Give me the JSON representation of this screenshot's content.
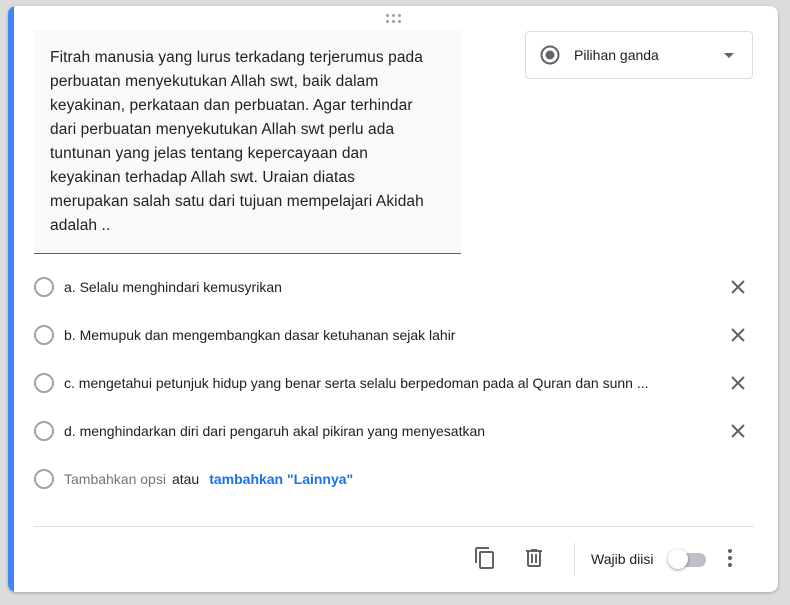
{
  "question": {
    "text": "Fitrah manusia yang lurus terkadang terjerumus pada\nperbuatan menyekutukan Allah swt, baik dalam\nkeyakinan, perkataan dan perbuatan. Agar terhindar\ndari perbuatan menyekutukan Allah swt perlu ada\ntuntunan yang jelas tentang kepercayaan dan\nkeyakinan terhadap Allah swt. Uraian diatas\nmerupakan salah satu dari tujuan mempelajari Akidah\nadalah .."
  },
  "question_type": {
    "label": "Pilihan ganda",
    "icon": "radio-button-icon"
  },
  "options": [
    {
      "label": "a. Selalu menghindari kemusyrikan"
    },
    {
      "label": "b. Memupuk dan mengembangkan dasar ketuhanan sejak lahir"
    },
    {
      "label": "c. mengetahui petunjuk hidup yang benar serta selalu berpedoman pada al Quran dan sunn ..."
    },
    {
      "label": "d. menghindarkan diri dari pengaruh akal pikiran yang menyesatkan"
    }
  ],
  "add_option": {
    "label": "Tambahkan opsi",
    "or_text": "atau",
    "add_other_link": "tambahkan \"Lainnya\""
  },
  "footer": {
    "required_label": "Wajib diisi",
    "required_on": false,
    "icons": [
      "duplicate-icon",
      "delete-icon",
      "more-options-icon"
    ]
  },
  "colors": {
    "accent": "#4285f4",
    "link": "#1a73e8"
  }
}
